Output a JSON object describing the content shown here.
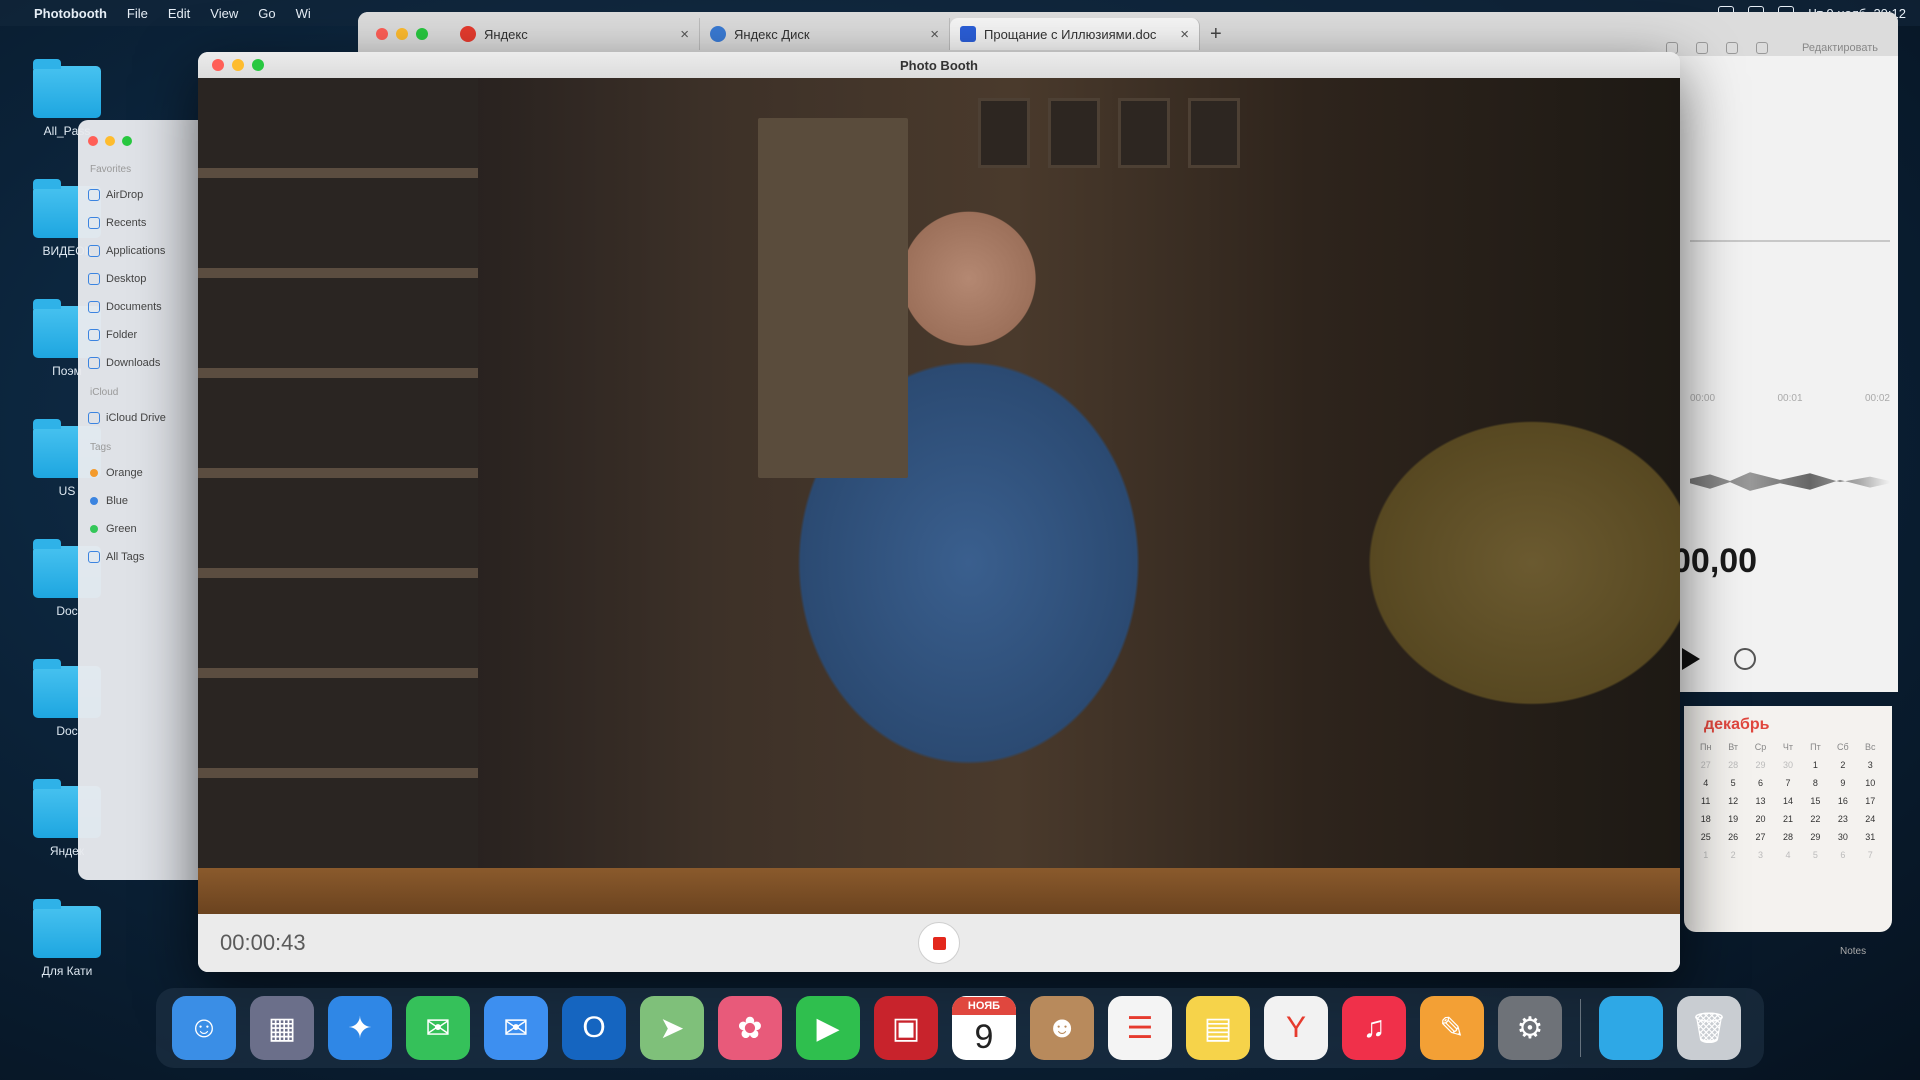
{
  "menubar": {
    "apple": "",
    "app_name": "Photobooth",
    "menus": [
      "File",
      "Edit",
      "View",
      "Go",
      "Wi"
    ],
    "clock": "Чт 9 нояб. 20:12"
  },
  "desktop_folders": [
    {
      "label": "All_Pass"
    },
    {
      "label": "ВИДЕОК"
    },
    {
      "label": "Поэм"
    },
    {
      "label": "US"
    },
    {
      "label": "Doc"
    },
    {
      "label": "Doc"
    },
    {
      "label": "Яндек"
    },
    {
      "label": "Для Кати"
    }
  ],
  "browser": {
    "tabs": [
      {
        "title": "Яндекс",
        "favicon_color": "#e63b2e"
      },
      {
        "title": "Яндекс Диск",
        "favicon_color": "#3a7bd5"
      },
      {
        "title": "Прощание с Иллюзиями.doc",
        "favicon_color": "#2b5fd9"
      }
    ],
    "new_tab": "+",
    "edit_link": "Редактировать"
  },
  "side_panel": {
    "time_marks": [
      "00:00",
      "00:01",
      "00:02"
    ],
    "amount": "00,00"
  },
  "calendar": {
    "month": "декабрь",
    "weekdays": [
      "Пн",
      "Вт",
      "Ср",
      "Чт",
      "Пт",
      "Сб",
      "Вс"
    ],
    "leading_muted": [
      "27",
      "28",
      "29",
      "30"
    ],
    "days": [
      "1",
      "2",
      "3",
      "4",
      "5",
      "6",
      "7",
      "8",
      "9",
      "10",
      "11",
      "12",
      "13",
      "14",
      "15",
      "16",
      "17",
      "18",
      "19",
      "20",
      "21",
      "22",
      "23",
      "24",
      "25",
      "26",
      "27",
      "28",
      "29",
      "30",
      "31"
    ],
    "trailing_muted": [
      "1",
      "2",
      "3",
      "4",
      "5",
      "6",
      "7"
    ],
    "footer": "Notes"
  },
  "finder": {
    "favorites_header": "Favorites",
    "favorites": [
      "AirDrop",
      "Recents",
      "Applications",
      "Desktop",
      "Documents",
      "Folder",
      "Downloads"
    ],
    "icloud_header": "iCloud",
    "icloud": [
      "iCloud Drive"
    ],
    "tags_header": "Tags",
    "tags": [
      {
        "label": "Orange",
        "color": "#f39a2b"
      },
      {
        "label": "Blue",
        "color": "#3b84e0"
      },
      {
        "label": "Green",
        "color": "#34c759"
      },
      {
        "label": "All Tags",
        "color": ""
      }
    ]
  },
  "photobooth": {
    "title": "Photo Booth",
    "timer": "00:00:43",
    "record_state": "recording"
  },
  "dock": {
    "apps": [
      {
        "name": "finder-icon",
        "glyph": "☺",
        "color": "#3a8ee6"
      },
      {
        "name": "launchpad-icon",
        "glyph": "▦",
        "color": "#6b6f8a"
      },
      {
        "name": "safari-icon",
        "glyph": "✦",
        "color": "#2f87e6"
      },
      {
        "name": "messages-icon",
        "glyph": "✉",
        "color": "#35c15a"
      },
      {
        "name": "mail-icon",
        "glyph": "✉",
        "color": "#3d8ff0"
      },
      {
        "name": "outlook-icon",
        "glyph": "O",
        "color": "#1565c0"
      },
      {
        "name": "maps-icon",
        "glyph": "➤",
        "color": "#7fc07a"
      },
      {
        "name": "photos-icon",
        "glyph": "✿",
        "color": "#e85a7a"
      },
      {
        "name": "facetime-icon",
        "glyph": "▶",
        "color": "#2fbf4e"
      },
      {
        "name": "photo-booth-icon",
        "glyph": "▣",
        "color": "#c8232c"
      }
    ],
    "calendar": {
      "month": "НОЯБ",
      "day": "9"
    },
    "apps_after": [
      {
        "name": "contacts-icon",
        "glyph": "☻",
        "color": "#b88a5c"
      },
      {
        "name": "reminders-icon",
        "glyph": "☰",
        "color": "#f4f4f4"
      },
      {
        "name": "notes-icon",
        "glyph": "▤",
        "color": "#f6d34a"
      },
      {
        "name": "yandex-browser-icon",
        "glyph": "Y",
        "color": "#f2f2f2"
      },
      {
        "name": "music-icon",
        "glyph": "♫",
        "color": "#f0304a"
      },
      {
        "name": "pages-icon",
        "glyph": "✎",
        "color": "#f3a035"
      },
      {
        "name": "system-settings-icon",
        "glyph": "⚙",
        "color": "#6e7278"
      }
    ],
    "downloads": {
      "name": "downloads-folder-icon",
      "glyph": "",
      "color": "#2ea8e6"
    },
    "trash": {
      "name": "trash-icon",
      "glyph": "🗑",
      "color": "#c9cdd2"
    }
  }
}
